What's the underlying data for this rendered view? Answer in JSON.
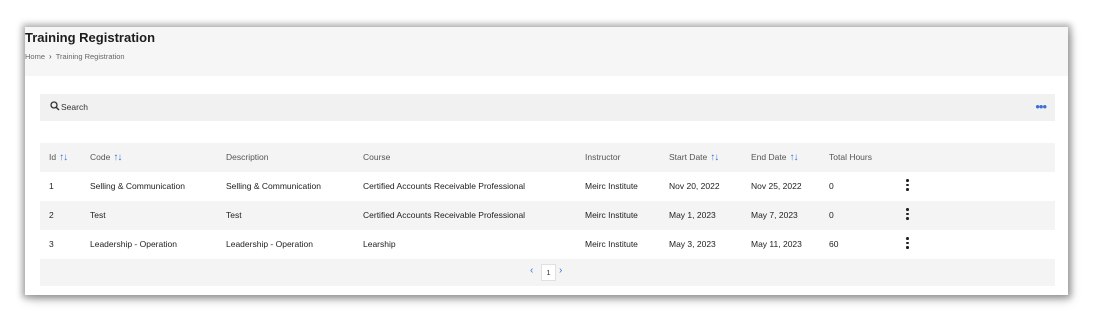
{
  "header": {
    "title": "Training Registration",
    "breadcrumb": [
      "Home",
      "Training Registration"
    ]
  },
  "search": {
    "placeholder": "Search"
  },
  "table": {
    "columns": [
      "Id",
      "Code",
      "Description",
      "Course",
      "Instructor",
      "Start Date",
      "End Date",
      "Total Hours"
    ],
    "rows": [
      [
        "1",
        "Selling & Communication",
        "Selling & Communication",
        "Certified Accounts Receivable Professional",
        "Meirc Institute",
        "Nov 20, 2022",
        "Nov 25, 2022",
        "0"
      ],
      [
        "2",
        "Test",
        "Test",
        "Certified Accounts Receivable Professional",
        "Meirc Institute",
        "May 1, 2023",
        "May 7, 2023",
        "0"
      ],
      [
        "3",
        "Leadership - Operation",
        "Leadership - Operation",
        "Learship",
        "Meirc Institute",
        "May 3, 2023",
        "May 11, 2023",
        "60"
      ]
    ]
  },
  "pagination": {
    "current_page": "1"
  },
  "colors": {
    "accent": "#3b6fd6",
    "header_bg": "#f6f6f6",
    "row_alt_bg": "#f4f4f4"
  }
}
